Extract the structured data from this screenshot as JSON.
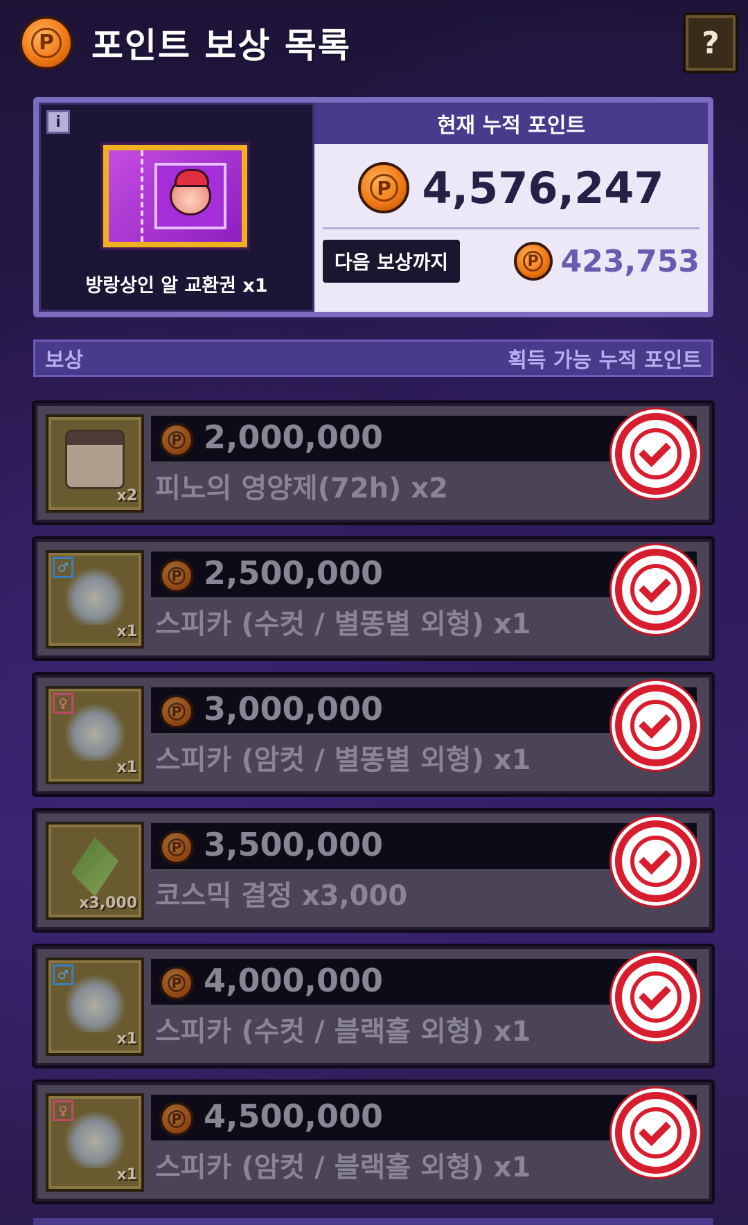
{
  "header": {
    "title": "포인트 보상 목록",
    "coin_symbol": "P",
    "help_label": "?"
  },
  "current_reward": {
    "info_label": "i",
    "name": "방랑상인 알 교환권 x1"
  },
  "points": {
    "title": "현재 누적 포인트",
    "total": "4,576,247",
    "next_label": "다음 보상까지",
    "next_value": "423,753"
  },
  "section": {
    "left": "보상",
    "right": "획득 가능 누적 포인트"
  },
  "rewards": [
    {
      "points": "2,000,000",
      "name": "피노의 영양제(72h) x2",
      "qty": "x2",
      "icon": "jar",
      "gender": ""
    },
    {
      "points": "2,500,000",
      "name": "스피카 (수컷 / 별똥별 외형) x1",
      "qty": "x1",
      "icon": "spica",
      "gender": "♂"
    },
    {
      "points": "3,000,000",
      "name": "스피카 (암컷 / 별똥별 외형) x1",
      "qty": "x1",
      "icon": "spica",
      "gender": "♀"
    },
    {
      "points": "3,500,000",
      "name": "코스믹 결정 x3,000",
      "qty": "x3,000",
      "icon": "crystal",
      "gender": ""
    },
    {
      "points": "4,000,000",
      "name": "스피카 (수컷 / 블랙홀 외형) x1",
      "qty": "x1",
      "icon": "spica",
      "gender": "♂"
    },
    {
      "points": "4,500,000",
      "name": "스피카 (암컷 / 블랙홀 외형) x1",
      "qty": "x1",
      "icon": "spica",
      "gender": "♀"
    }
  ],
  "colors": {
    "accent": "#4a3a8c",
    "coin": "#f07a15",
    "claimed_check": "#d81e2e"
  }
}
